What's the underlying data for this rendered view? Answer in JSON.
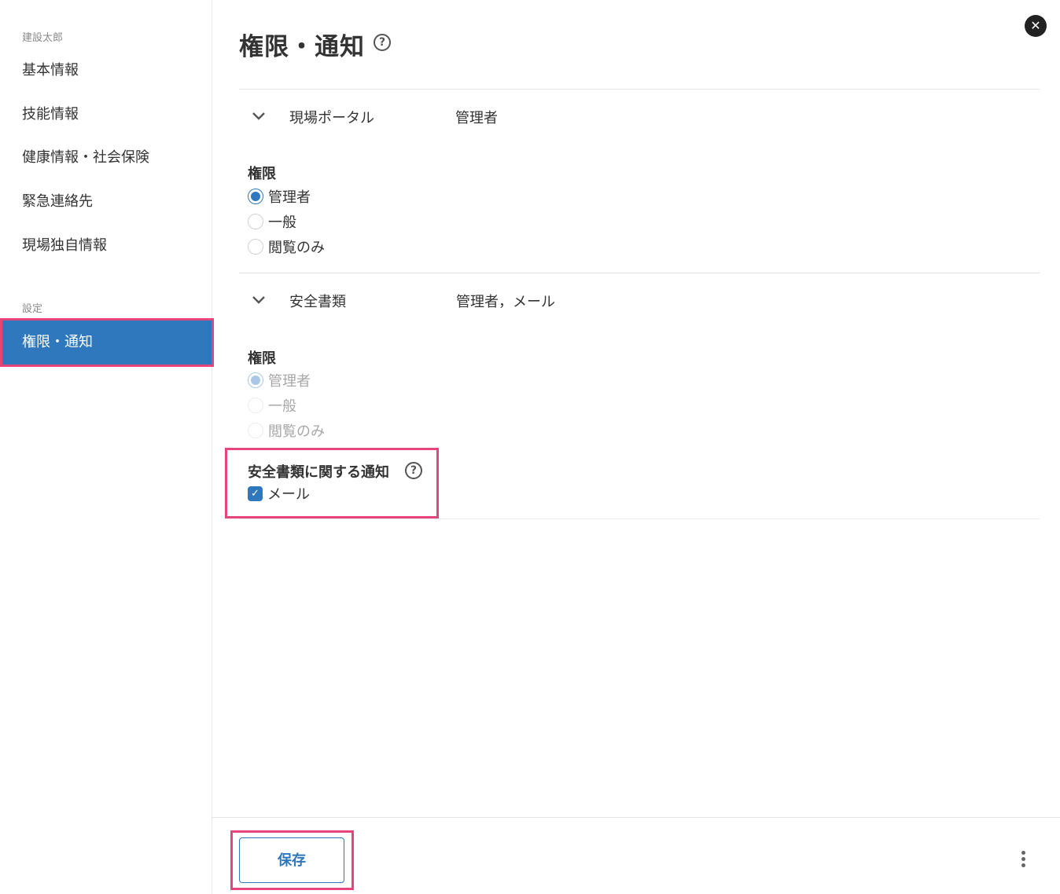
{
  "sidebar": {
    "user_name": "建設太郎",
    "items": [
      {
        "label": "基本情報"
      },
      {
        "label": "技能情報"
      },
      {
        "label": "健康情報・社会保険"
      },
      {
        "label": "緊急連絡先"
      },
      {
        "label": "現場独自情報"
      }
    ],
    "settings_caption": "設定",
    "active_item": "権限・通知"
  },
  "main": {
    "title": "権限・通知",
    "help_glyph": "?",
    "close_glyph": "✕",
    "sections": [
      {
        "name": "現場ポータル",
        "summary": "管理者",
        "permission_label": "権限",
        "options": [
          "管理者",
          "一般",
          "閲覧のみ"
        ],
        "selected": "管理者"
      },
      {
        "name": "安全書類",
        "summary": "管理者，メール",
        "permission_label": "権限",
        "options": [
          "管理者",
          "一般",
          "閲覧のみ"
        ],
        "selected": "管理者",
        "notification_label": "安全書類に関する通知",
        "notification_option": "メール",
        "notification_checked": true
      }
    ]
  },
  "footer": {
    "save_label": "保存"
  },
  "colors": {
    "accent": "#2f78bd",
    "highlight": "#e5457a"
  }
}
